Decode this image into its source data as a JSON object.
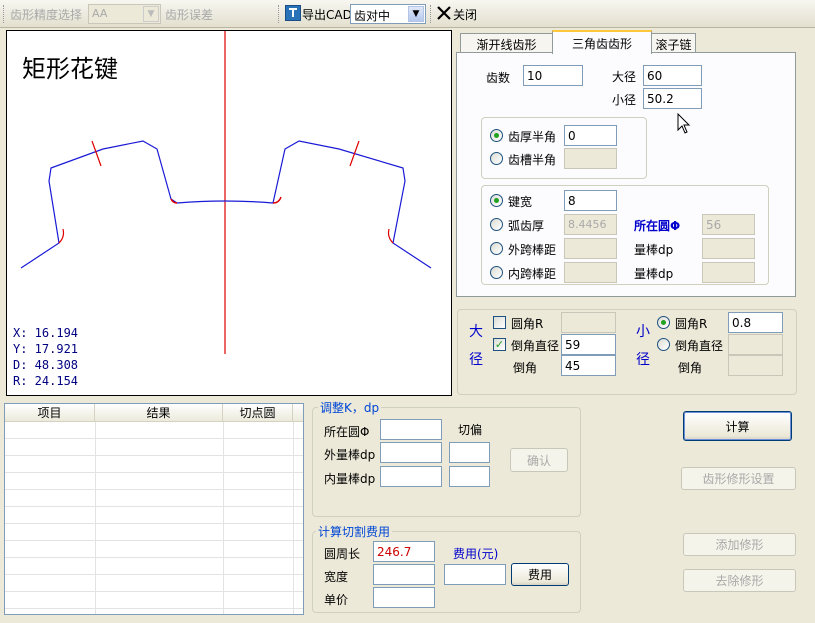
{
  "toolbar": {
    "precision_label": "齿形精度选择",
    "precision_value": "AA",
    "error_label": "齿形误差",
    "export_label": "导出CAD",
    "align_value": "齿对中",
    "close_label": "关闭"
  },
  "canvas": {
    "title": "矩形花键",
    "readouts": [
      "X:  16.194",
      "Y:  17.921",
      "D:  48.308",
      "R:  24.154"
    ]
  },
  "tabs": [
    "渐开线齿形",
    "三角齿齿形",
    "滚子链"
  ],
  "teeth": {
    "tooth_count_label": "齿数",
    "tooth_count": "10",
    "major_dia_label": "大径",
    "major_dia": "60",
    "minor_dia_label": "小径",
    "minor_dia": "50.2",
    "tooth_thick_half_label": "齿厚半角",
    "tooth_thick_half": "0",
    "slot_half_label": "齿槽半角",
    "slot_half": "",
    "key_width_label": "键宽",
    "key_width": "8",
    "arc_thick_label": "弧齿厚",
    "arc_thick": "8.4456",
    "location_label": "所在圆Φ",
    "location": "56",
    "outer_span_label": "外跨棒距",
    "outer_span": "",
    "inner_span_label": "内跨棒距",
    "inner_span": "",
    "bar_dp_label_1": "量棒dp",
    "bar_dp_1": "",
    "bar_dp_label_2": "量棒dp",
    "bar_dp_2": ""
  },
  "corners": {
    "big_label": "大径",
    "small_label": "小径",
    "fillet_label": "圆角R",
    "big_fillet": "",
    "chamfer_dia_label": "倒角直径",
    "big_chamfer_dia": "59",
    "chamfer_label": "倒角",
    "big_chamfer": "45",
    "small_fillet": "0.8",
    "small_chamfer_dia": "",
    "small_chamfer": ""
  },
  "results": {
    "headers": [
      "项目",
      "结果",
      "切点圆"
    ]
  },
  "adjust": {
    "title": "调整K，dp",
    "location_label": "所在圆Φ",
    "cut_label": "切偏",
    "outer_bar_label": "外量棒dp",
    "inner_bar_label": "内量棒dp",
    "confirm_label": "确认"
  },
  "cost": {
    "title": "计算切割费用",
    "circumference_label": "圆周长",
    "circumference": "246.7",
    "width_label": "宽度",
    "unit_price_label": "单价",
    "fee_label": "费用(元)",
    "fee_button": "费用"
  },
  "buttons": {
    "calc": "计算",
    "modify_settings": "齿形修形设置",
    "add_mod": "添加修形",
    "remove_mod": "去除修形"
  }
}
